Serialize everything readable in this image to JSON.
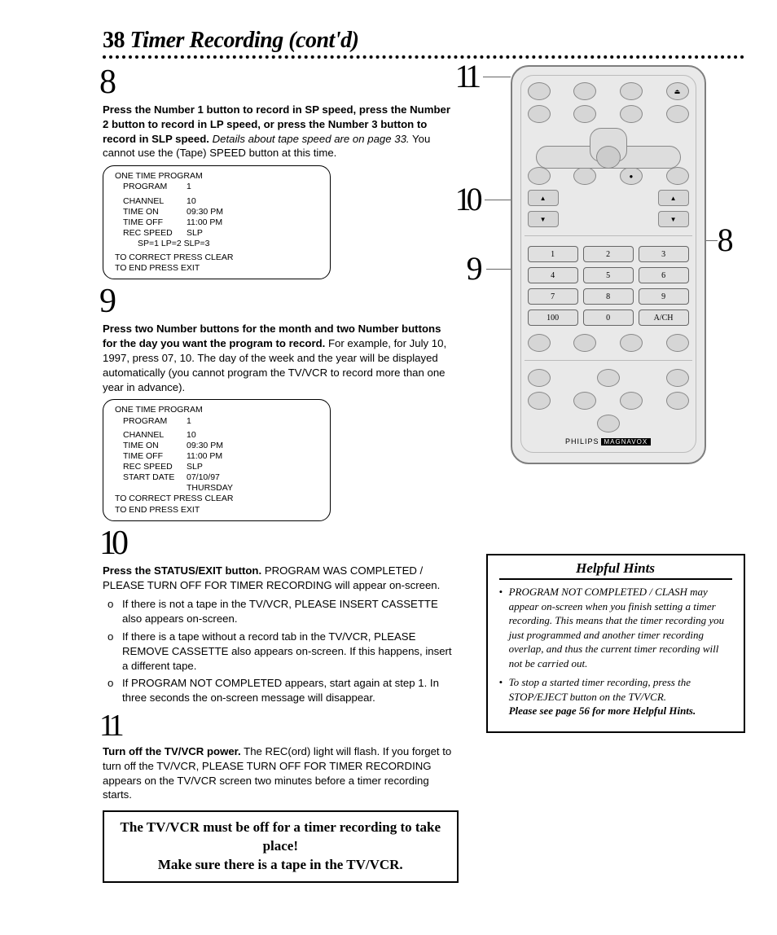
{
  "page": {
    "number": "38",
    "title": "Timer Recording (cont'd)"
  },
  "step8": {
    "glyph": "8",
    "bold": "Press the Number 1 button to record in SP speed, press the Number 2 button to record in LP speed, or press the Number 3 button to record in SLP speed.",
    "italic": "Details about tape speed are on page 33.",
    "rest": "You cannot use the (Tape) SPEED button at this time."
  },
  "osd1": {
    "title": "ONE TIME PROGRAM",
    "program_lbl": "PROGRAM",
    "program_val": "1",
    "channel_lbl": "CHANNEL",
    "channel_val": "10",
    "timeon_lbl": "TIME ON",
    "timeon_val": "09:30 PM",
    "timeoff_lbl": "TIME OFF",
    "timeoff_val": "11:00 PM",
    "recspeed_lbl": "REC SPEED",
    "recspeed_val": "SLP",
    "speeds": "SP=1  LP=2  SLP=3",
    "footer1": "TO CORRECT PRESS CLEAR",
    "footer2": "TO END PRESS EXIT"
  },
  "step9": {
    "glyph": "9",
    "bold": "Press two Number buttons for the month and two Number buttons for the day you want the program to record.",
    "rest": "For example, for July 10, 1997, press 07, 10. The day of the week and the year will be displayed automatically (you cannot program the TV/VCR to record more than one year in advance)."
  },
  "osd2": {
    "title": "ONE TIME PROGRAM",
    "program_lbl": "PROGRAM",
    "program_val": "1",
    "channel_lbl": "CHANNEL",
    "channel_val": "10",
    "timeon_lbl": "TIME ON",
    "timeon_val": "09:30 PM",
    "timeoff_lbl": "TIME OFF",
    "timeoff_val": "11:00 PM",
    "recspeed_lbl": "REC SPEED",
    "recspeed_val": "SLP",
    "startdate_lbl": "START DATE",
    "startdate_val": "07/10/97",
    "day": "THURSDAY",
    "footer1": "TO CORRECT PRESS CLEAR",
    "footer2": "TO END PRESS EXIT"
  },
  "step10": {
    "glyph": "10",
    "bold": "Press the STATUS/EXIT button.",
    "rest": "PROGRAM WAS COMPLETED / PLEASE TURN OFF FOR TIMER RECORDING will appear on-screen.",
    "bullets": [
      "If there is not a tape in the TV/VCR, PLEASE INSERT CASSETTE also appears on-screen.",
      "If there is a tape without a record tab in the TV/VCR, PLEASE REMOVE CASSETTE also appears on-screen. If this happens, insert a different tape.",
      "If PROGRAM NOT COMPLETED appears, start again at step 1. In three seconds the on-screen message will disappear."
    ]
  },
  "step11": {
    "glyph": "11",
    "bold": "Turn off the TV/VCR power.",
    "rest": "The REC(ord) light will flash. If you forget to turn off the TV/VCR, PLEASE TURN OFF FOR TIMER RECORDING appears on the TV/VCR screen two minutes before a timer recording starts."
  },
  "bignote": {
    "line1": "The TV/VCR must be off for a timer recording to take place!",
    "line2": "Make sure there is a tape in the TV/VCR."
  },
  "remote": {
    "brand": "PHILIPS",
    "brand2": "MAGNAVOX",
    "nums": [
      "1",
      "2",
      "3",
      "4",
      "5",
      "6",
      "7",
      "8",
      "9",
      "100",
      "0",
      "A/CH"
    ]
  },
  "callouts": {
    "c8": "8",
    "c9": "9",
    "c10": "10",
    "c11": "11"
  },
  "hints": {
    "title": "Helpful Hints",
    "items": [
      "PROGRAM NOT COMPLETED / CLASH may appear on-screen when you finish setting a timer recording. This means that the timer recording you just programmed and another timer recording overlap, and thus the current timer recording will not be carried out.",
      "To stop a started timer recording, press the STOP/EJECT button on the TV/VCR."
    ],
    "see": "Please see page 56 for more Helpful Hints."
  }
}
